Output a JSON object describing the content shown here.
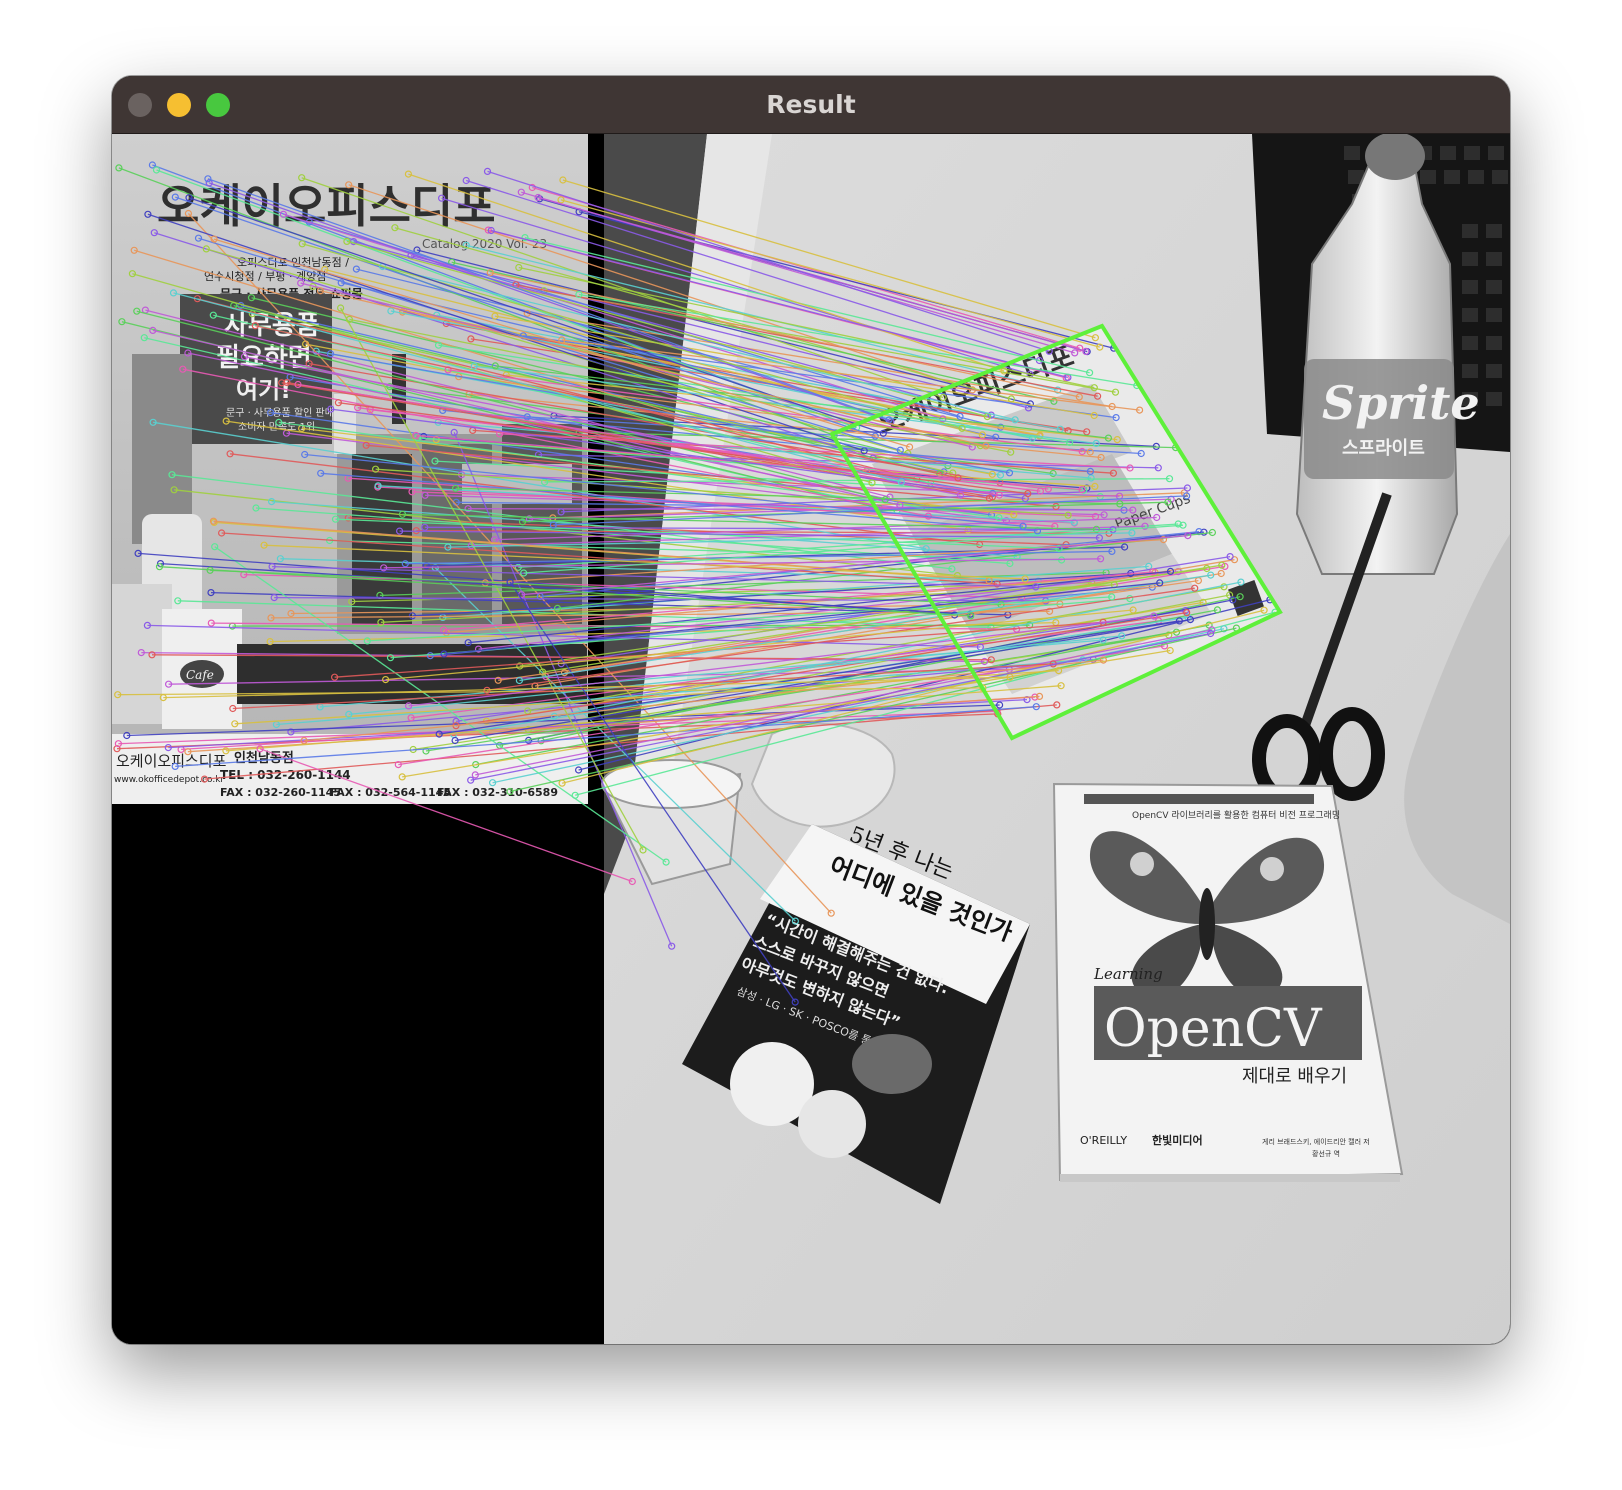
{
  "window": {
    "title": "Result",
    "controls": [
      "close",
      "minimize",
      "maximize"
    ]
  },
  "query_image": {
    "title": "오케이오피스디포",
    "catalog": "Catalog 2020 Vol. 23",
    "tagline_1": "오피스디포 인천남동점 /",
    "tagline_2": "연수시청점 / 부평 · 계양점",
    "tagline_3": "문구 · 사무용품 전문 쇼핑몰",
    "headline_1": "사무용품",
    "headline_2": "필요하면",
    "headline_3": "여기!",
    "sub_1": "문구 · 사무용품 할인 판매",
    "sub_2": "소비자 만족도 1위",
    "cup_label": "Cafe",
    "footer_brand": "오케이오피스디포",
    "footer_url": "www.okofficedepot.co.kr",
    "store": "인천남동점",
    "tel": "TEL : 032-260-1144",
    "fax_1": "FAX : 032-260-1145",
    "fax_2": "FAX : 032-564-1145",
    "fax_3": "FAX : 032-310-6589"
  },
  "scene": {
    "bottle_brand": "Sprite",
    "bottle_korean": "스프라이트",
    "catalog_cups": "Paper Cups",
    "book1_title_1": "5년 후 나는",
    "book1_title_2": "어디에 있을 것인가",
    "book1_quote_1": "“시간이 해결해주는 건 없다.",
    "book1_quote_2": "스스로 바꾸지 않으면",
    "book1_quote_3": "아무것도 변하지 않는다”",
    "book1_brands": "삼성 · LG · SK · POSCO를 통한",
    "book2_series": "OpenCV 라이브러리를 활용한 컴퓨터 비전 프로그래밍",
    "book2_learning": "Learning",
    "book2_title": "OpenCV",
    "book2_subtitle": "제대로 배우기",
    "book2_publisher_1": "O'REILLY",
    "book2_publisher_2": "한빛미디어",
    "book2_authors": "게리 브래드스키, 에이드리안 캘러 저",
    "book2_translator": "황선규 역"
  },
  "match_colors": [
    "#e05a5a",
    "#5ad05a",
    "#5a7ae8",
    "#d8c040",
    "#c05ad8",
    "#5ad0d0",
    "#e8965a",
    "#8a5ae8",
    "#5ae896",
    "#e85ab4",
    "#a0d040",
    "#4040c0"
  ],
  "detection_box_color": "#5ef03a"
}
